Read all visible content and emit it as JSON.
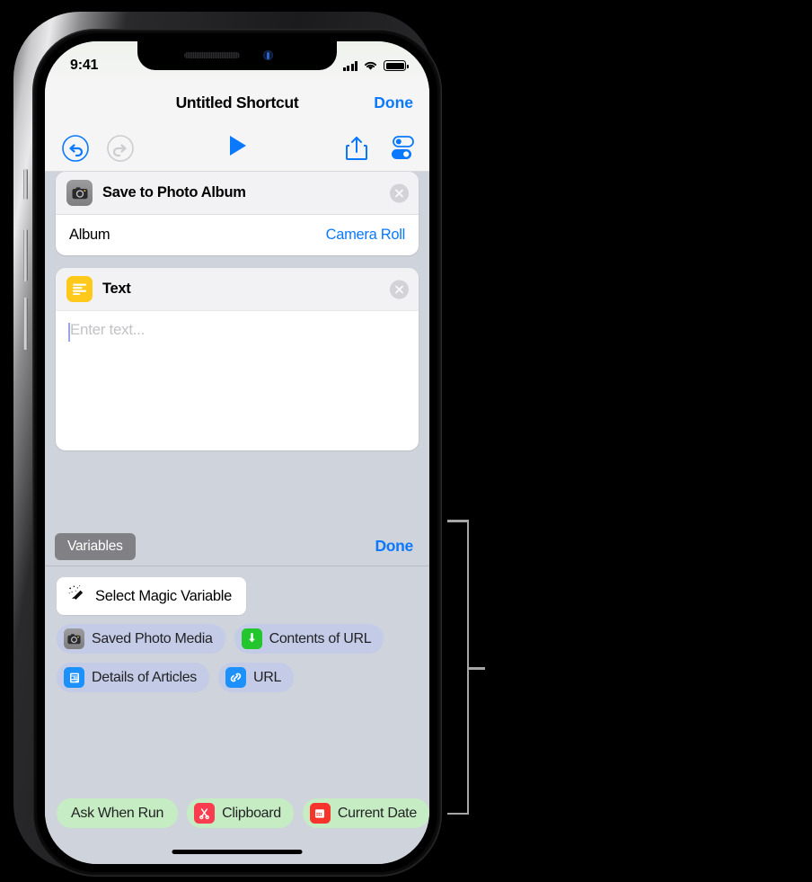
{
  "status_bar": {
    "time": "9:41",
    "signal_icon": "cellular-bars-icon",
    "wifi_icon": "wifi-icon",
    "battery_icon": "battery-full-icon"
  },
  "nav_bar": {
    "title": "Untitled Shortcut",
    "done_label": "Done"
  },
  "toolbar": {
    "undo_icon": "undo-icon",
    "redo_icon": "redo-icon",
    "play_icon": "play-icon",
    "share_icon": "share-icon",
    "settings_icon": "settings-toggles-icon"
  },
  "actions": [
    {
      "icon": "camera-icon",
      "title": "Save to Photo Album",
      "remove_label": "close-icon",
      "rows": [
        {
          "label": "Album",
          "value": "Camera Roll"
        }
      ]
    },
    {
      "icon": "text-lines-icon",
      "title": "Text",
      "remove_label": "close-icon",
      "placeholder": "Enter text...",
      "value": ""
    }
  ],
  "variables_panel": {
    "tab_label": "Variables",
    "done_label": "Done",
    "magic_variable_button": {
      "icon": "magic-wand-icon",
      "label": "Select Magic Variable"
    },
    "magic_variables": [
      {
        "label": "Saved Photo Media",
        "icon": "camera-icon",
        "icon_color": "#8b8b8e",
        "chip_color": "#c3cbe6"
      },
      {
        "label": "Contents of URL",
        "icon": "download-icon",
        "icon_color": "#24c62e",
        "chip_color": "#c3cbe6"
      },
      {
        "label": "Details of Articles",
        "icon": "article-icon",
        "icon_color": "#1d91fb",
        "chip_color": "#c3cbe6"
      },
      {
        "label": "URL",
        "icon": "link-icon",
        "icon_color": "#1d91fb",
        "chip_color": "#c3cbe6"
      }
    ],
    "special_variables": [
      {
        "label": "Ask When Run",
        "icon": "",
        "chip_color": "#c5ecc2"
      },
      {
        "label": "Clipboard",
        "icon": "scissors-icon",
        "icon_color": "#fa3c4f",
        "chip_color": "#c5ecc2"
      },
      {
        "label": "Current Date",
        "icon": "calendar-icon",
        "icon_color": "#f6342b",
        "chip_color": "#c5ecc2"
      }
    ]
  },
  "colors": {
    "accent_blue": "#0b79fe",
    "panel_background": "#cfd3dc",
    "toolbar_background": "#f5f5f5",
    "card_background": "#ffffff",
    "variables_tab": "#808085"
  },
  "callout": {
    "annotation_icon": "callout-bracket"
  }
}
